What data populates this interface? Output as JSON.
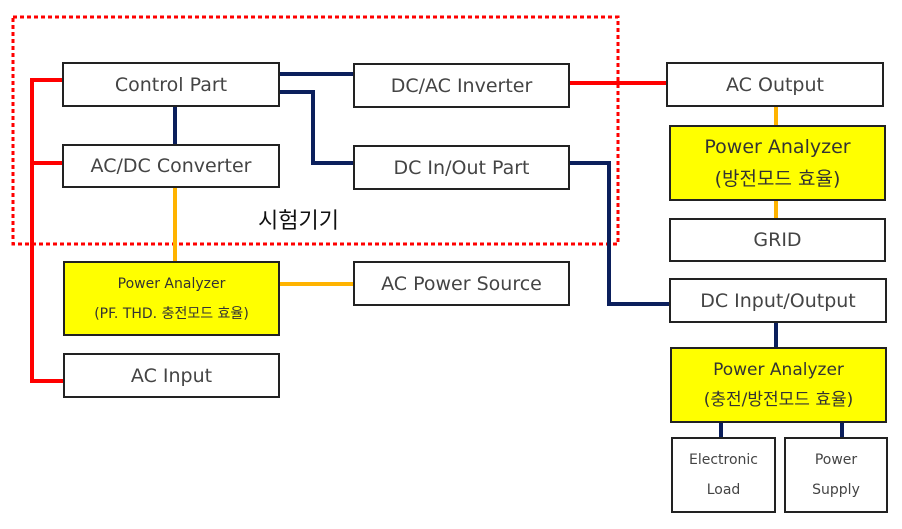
{
  "colors": {
    "ac_line": "#ff0000",
    "dc_line": "#0b1f5c",
    "measure_line": "#ffb300",
    "analyzer_fill": "#ffff00",
    "boundary": "#ff0000"
  },
  "boundary_label": "시험기기",
  "boxes": {
    "control_part": "Control Part",
    "acdc_converter": "AC/DC Converter",
    "dcac_inverter": "DC/AC Inverter",
    "dc_inout_part": "DC In/Out Part",
    "pa_left": {
      "line1": "Power Analyzer",
      "line2": "(PF. THD. 충전모드 효율)"
    },
    "ac_power_source": "AC Power Source",
    "ac_input": "AC Input",
    "ac_output": "AC Output",
    "pa_discharge": {
      "line1": "Power Analyzer",
      "line2": "(방전모드 효율)"
    },
    "grid": "GRID",
    "dc_input_output": "DC Input/Output",
    "pa_charge_discharge": {
      "line1": "Power Analyzer",
      "line2": "(충전/방전모드 효율)"
    },
    "electronic_load": {
      "line1": "Electronic",
      "line2": "Load"
    },
    "power_supply": {
      "line1": "Power",
      "line2": "Supply"
    }
  }
}
